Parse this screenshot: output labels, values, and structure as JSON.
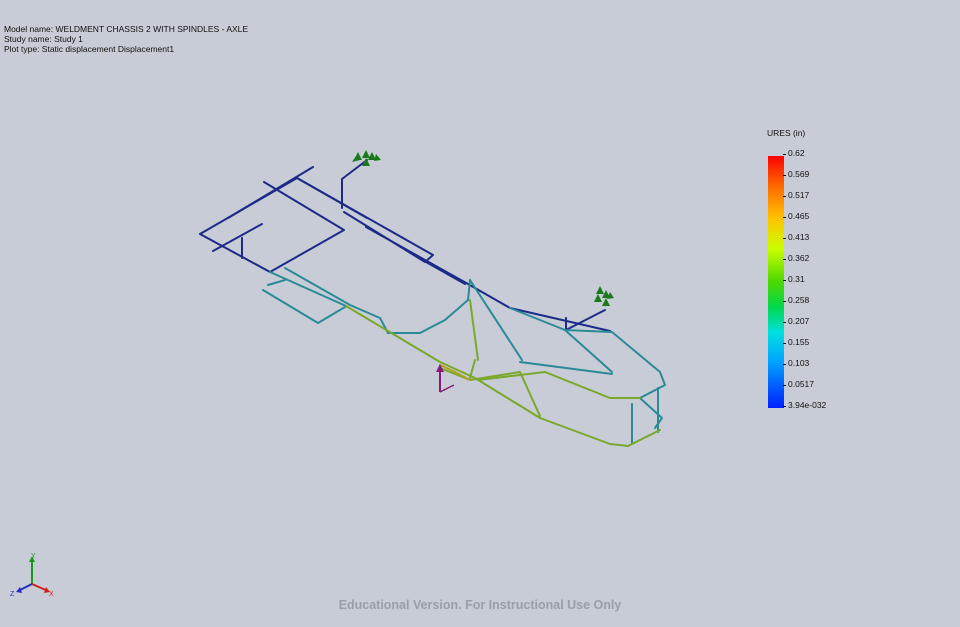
{
  "header": {
    "model_name": "Model name: WELDMENT CHASSIS 2 WITH SPINDLES - AXLE",
    "study_name": "Study name: Study 1",
    "plot_type": "Plot type: Static displacement Displacement1"
  },
  "legend": {
    "title": "URES (in)",
    "labels": [
      "0.62",
      "0.569",
      "0.517",
      "0.465",
      "0.413",
      "0.362",
      "0.31",
      "0.258",
      "0.207",
      "0.155",
      "0.103",
      "0.0517",
      "3.94e-032"
    ],
    "colors": [
      "#ff0000",
      "#ff6a00",
      "#ffc400",
      "#c8ff00",
      "#4cd800",
      "#00d84c",
      "#00e0e0",
      "#00a0ff",
      "#0020ff"
    ]
  },
  "triad": {
    "x_label": "X",
    "y_label": "Y",
    "z_label": "Z"
  },
  "watermark": "Educational Version. For Instructional Use Only",
  "colors": {
    "background": "#c8ccd6",
    "frame_low": "#1a2a8c",
    "frame_mid": "#2a7a9a",
    "frame_teal": "#2e9a8c",
    "frame_high": "#6aa020",
    "fixture": "#1a7a1a",
    "load_arrow": "#8a1a7a"
  }
}
